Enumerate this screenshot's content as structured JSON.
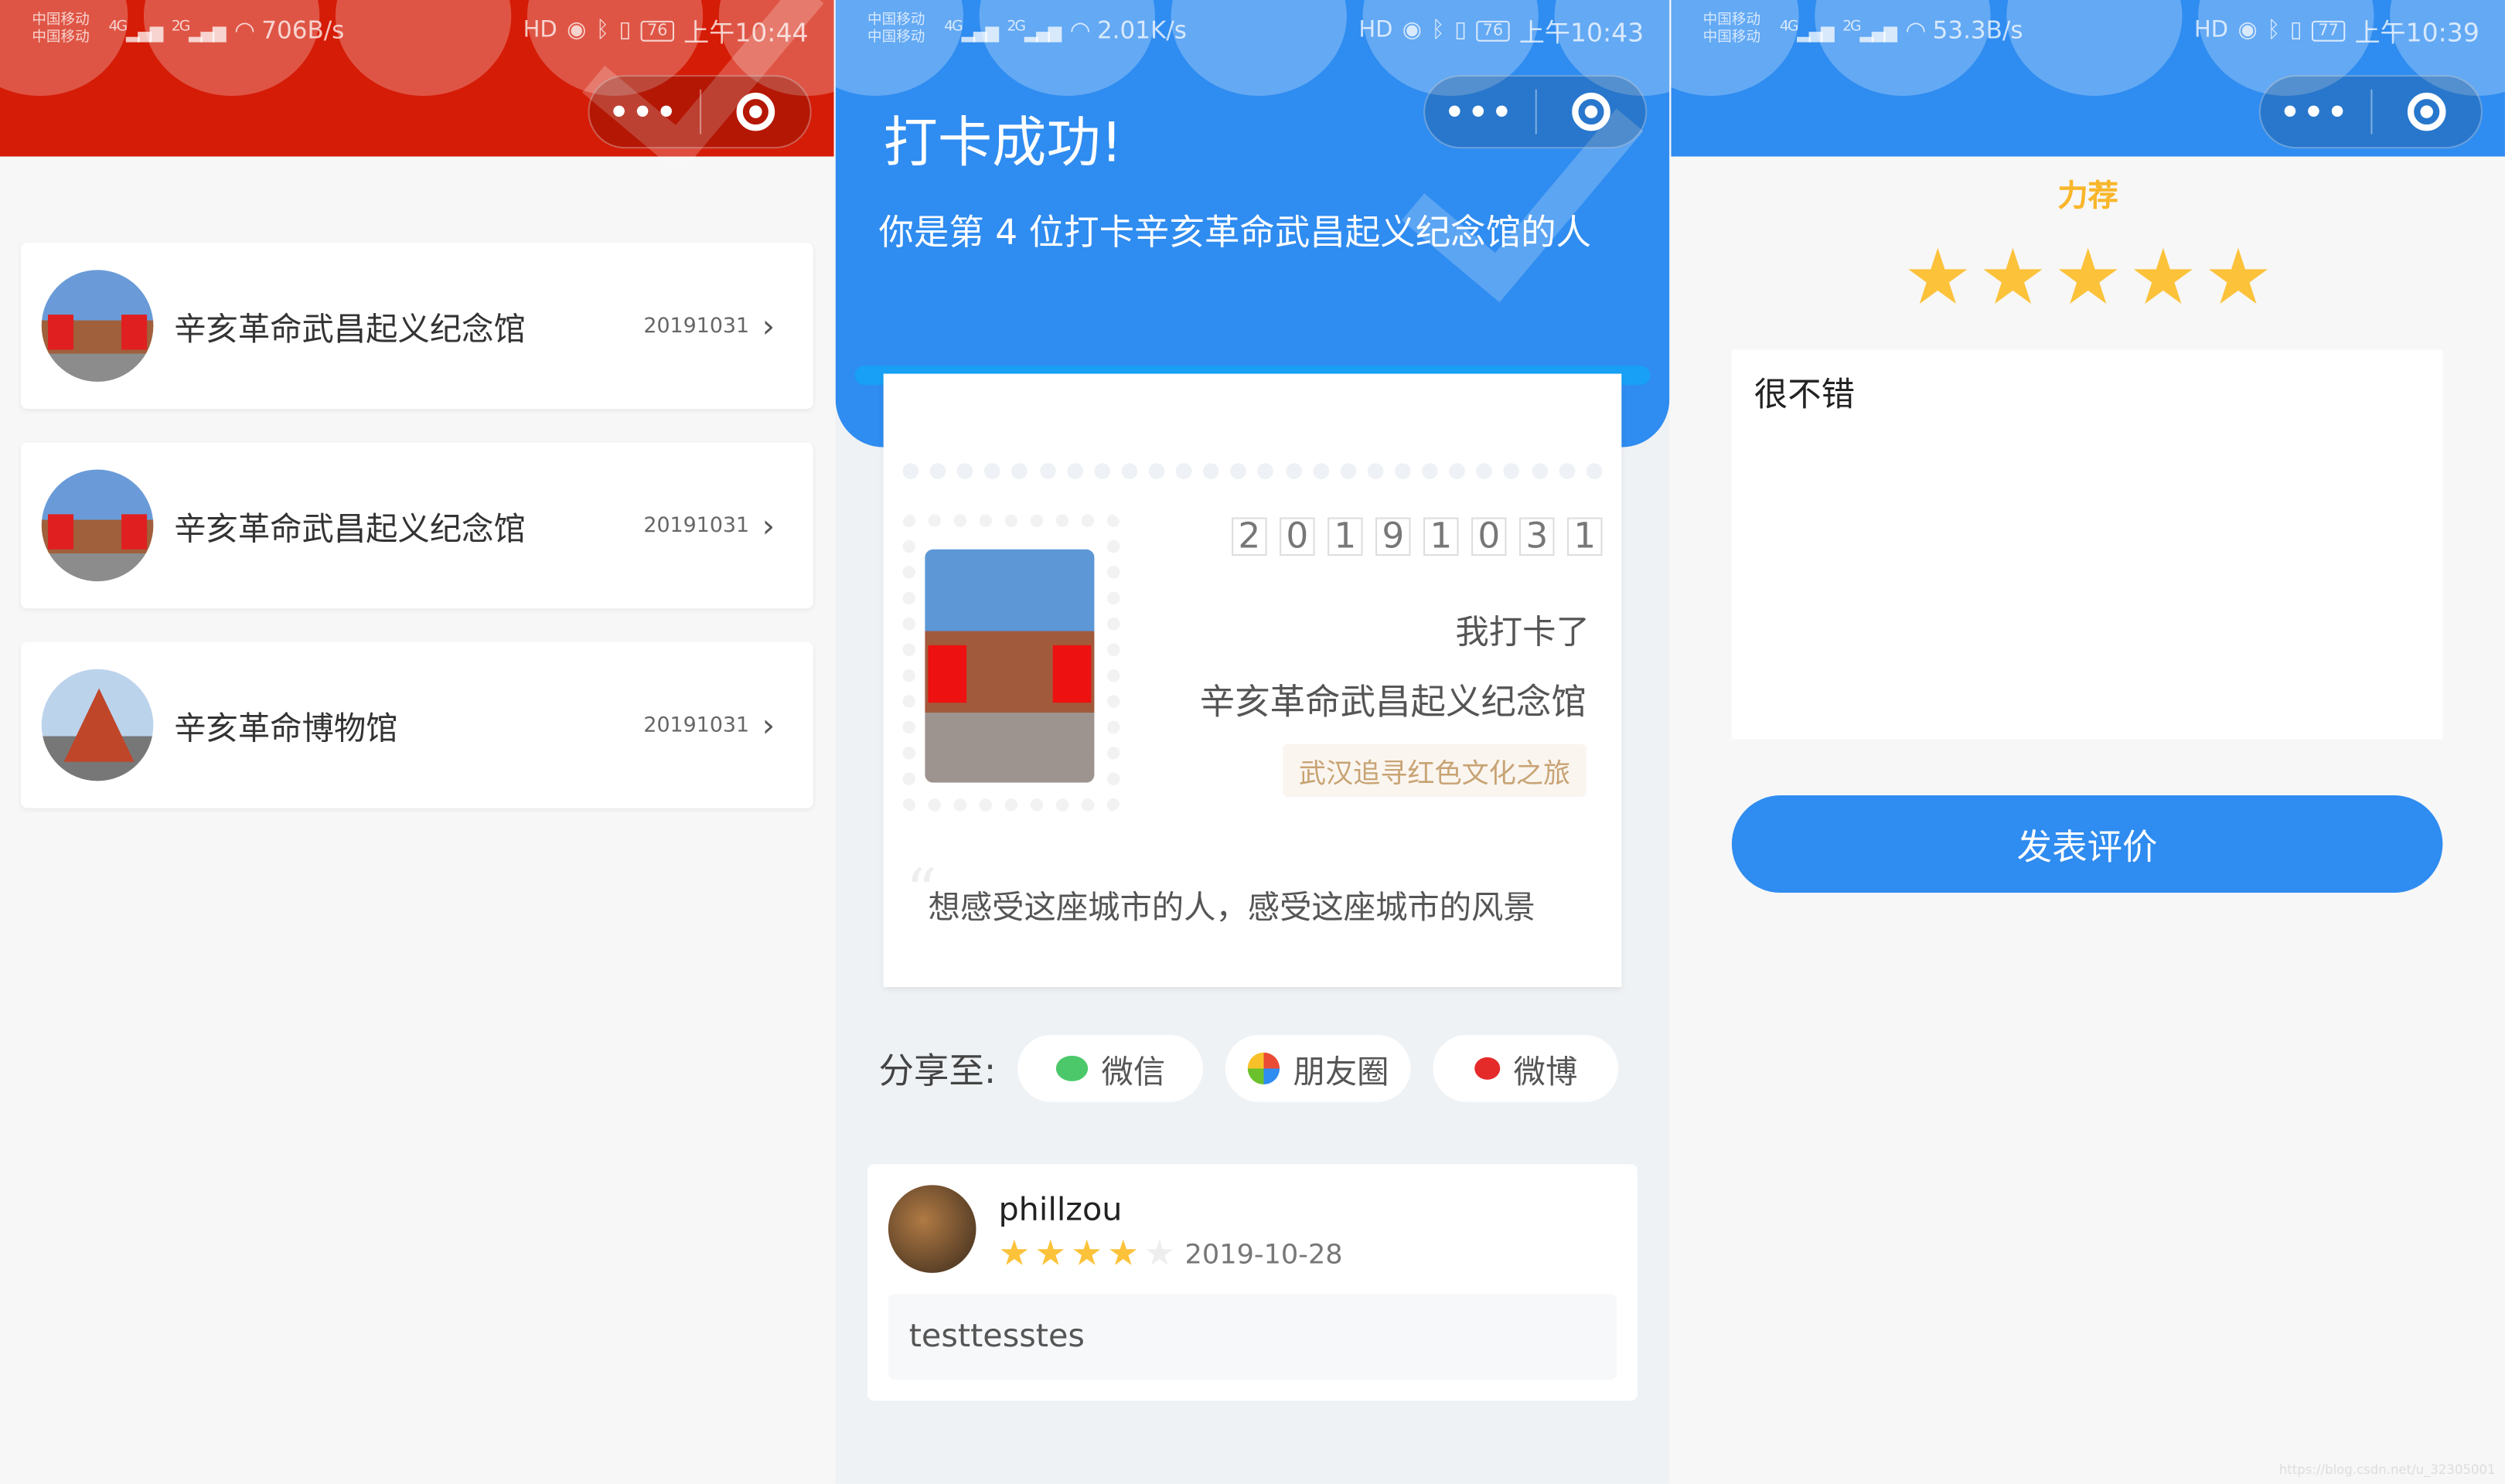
{
  "colors": {
    "red_header": "#d51c07",
    "blue_header": "#2f8cf0",
    "star": "#fcc23a",
    "tag_text": "#c8a374"
  },
  "status_bars": [
    {
      "carrier1": "中国移动",
      "carrier2": "中国移动",
      "sig1": "4G",
      "sig2": "2G",
      "speed": "706B/s",
      "hd": "HD",
      "battery": "76",
      "time": "上午10:44"
    },
    {
      "carrier1": "中国移动",
      "carrier2": "中国移动",
      "sig1": "4G",
      "sig2": "2G",
      "speed": "2.01K/s",
      "hd": "HD",
      "battery": "76",
      "time": "上午10:43"
    },
    {
      "carrier1": "中国移动",
      "carrier2": "中国移动",
      "sig1": "4G",
      "sig2": "2G",
      "speed": "53.3B/s",
      "hd": "HD",
      "battery": "77",
      "time": "上午10:39"
    }
  ],
  "capsule": {
    "more": "•••"
  },
  "list": {
    "items": [
      {
        "name": "辛亥革命武昌起义纪念馆",
        "date": "20191031",
        "thumb": "building"
      },
      {
        "name": "辛亥革命武昌起义纪念馆",
        "date": "20191031",
        "thumb": "building"
      },
      {
        "name": "辛亥革命博物馆",
        "date": "20191031",
        "thumb": "museum"
      }
    ],
    "chevron": "›"
  },
  "checkin": {
    "title": "打卡成功!",
    "subtitle": "你是第 4 位打卡辛亥革命武昌起义纪念馆的人",
    "digits": [
      "2",
      "0",
      "1",
      "9",
      "1",
      "0",
      "3",
      "1"
    ],
    "line1": "我打卡了",
    "place": "辛亥革命武昌起义纪念馆",
    "tag": "武汉追寻红色文化之旅",
    "quote_mark": "“",
    "quote": "想感受这座城市的人，感受这座城市的风景",
    "share_label": "分享至:",
    "share": [
      {
        "label": "微信",
        "icon": "wechat-icon"
      },
      {
        "label": "朋友圈",
        "icon": "moments-icon"
      },
      {
        "label": "微博",
        "icon": "weibo-icon"
      }
    ],
    "review": {
      "user": "phillzou",
      "rating": 4,
      "max": 5,
      "date": "2019-10-28",
      "text": "testtesstes"
    }
  },
  "rate": {
    "heading": "力荐",
    "rating": 5,
    "text": "很不错",
    "submit": "发表评价"
  },
  "watermark": "https://blog.csdn.net/u_32305001"
}
